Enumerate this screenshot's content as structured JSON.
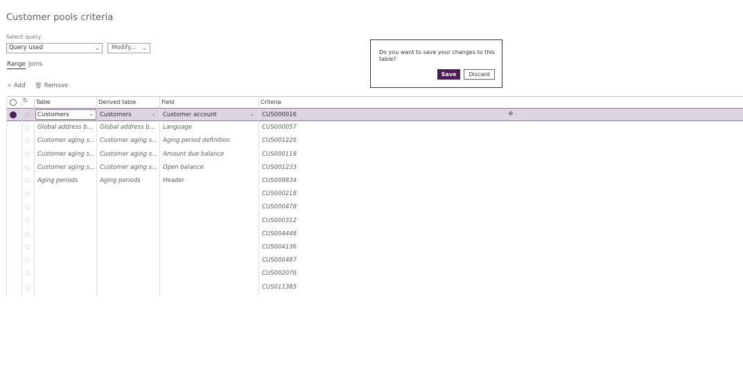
{
  "page": {
    "title": "Customer pools criteria"
  },
  "query": {
    "label": "Select query",
    "selected": "Query used",
    "modify_label": "Modify..."
  },
  "tabs": [
    {
      "label": "Range",
      "active": true
    },
    {
      "label": "Joins",
      "active": false
    }
  ],
  "toolbar": {
    "add_label": "Add",
    "remove_label": "Remove"
  },
  "popup": {
    "message": "Do you want to save your changes to this table?",
    "save_label": "Save",
    "discard_label": "Discard"
  },
  "grid": {
    "headers": {
      "table": "Table",
      "derived": "Derived table",
      "field": "Field",
      "criteria": "Criteria"
    },
    "rows": [
      {
        "table": "Customers",
        "derived": "Customers",
        "field": "Customer account",
        "criteria": "CUS000016"
      },
      {
        "table": "Global address b...",
        "derived": "Global address b...",
        "field": "Language",
        "criteria": "CUS000057"
      },
      {
        "table": "Customer aging s...",
        "derived": "Customer aging s...",
        "field": "Aging period definition",
        "criteria": "CUS001226"
      },
      {
        "table": "Customer aging s...",
        "derived": "Customer aging s...",
        "field": "Amount due balance",
        "criteria": "CUS000118"
      },
      {
        "table": "Customer aging s...",
        "derived": "Customer aging s...",
        "field": "Open balance",
        "criteria": "CUS001233"
      },
      {
        "table": "Aging periods",
        "derived": "Aging periods",
        "field": "Header",
        "criteria": "CUS009834"
      },
      {
        "table": "",
        "derived": "",
        "field": "",
        "criteria": "CUS000218"
      },
      {
        "table": "",
        "derived": "",
        "field": "",
        "criteria": "CUS000478"
      },
      {
        "table": "",
        "derived": "",
        "field": "",
        "criteria": "CUS000312"
      },
      {
        "table": "",
        "derived": "",
        "field": "",
        "criteria": "CUS004448"
      },
      {
        "table": "",
        "derived": "",
        "field": "",
        "criteria": "CUS004136"
      },
      {
        "table": "",
        "derived": "",
        "field": "",
        "criteria": "CUS000487"
      },
      {
        "table": "",
        "derived": "",
        "field": "",
        "criteria": "CUS002076"
      },
      {
        "table": "",
        "derived": "",
        "field": "",
        "criteria": "CUS011385"
      }
    ]
  },
  "colors": {
    "accent": "#4b1e58",
    "selected_row": "#dcd6e1"
  }
}
